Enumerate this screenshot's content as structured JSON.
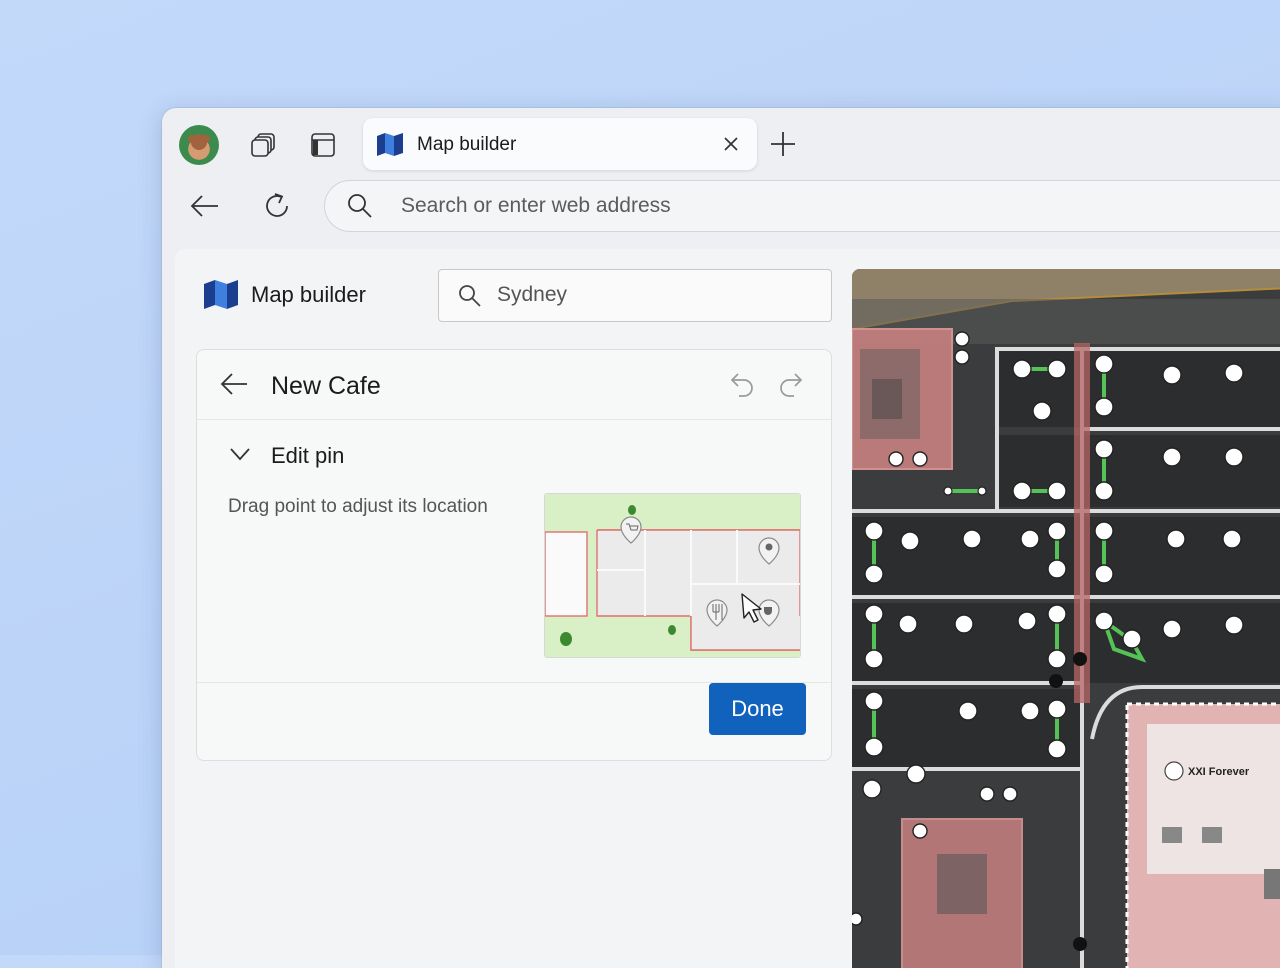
{
  "browser": {
    "tab_title": "Map builder",
    "address_placeholder": "Search or enter web address",
    "icons": [
      "avatar",
      "workspaces-icon",
      "tab-actions-icon",
      "close-icon",
      "plus-icon",
      "back-arrow-icon",
      "refresh-icon",
      "search-icon"
    ]
  },
  "app": {
    "title": "Map builder",
    "search_value": "Sydney"
  },
  "panel": {
    "title": "New Cafe",
    "section_title": "Edit pin",
    "hint": "Drag point to adjust its location",
    "done_label": "Done"
  },
  "map": {
    "store_label": "XXI Forever"
  },
  "colors": {
    "accent": "#1062bd",
    "page_background": "#bcd4f7",
    "building_highlight": "#d98a8a",
    "path_green": "#5ac85a"
  }
}
